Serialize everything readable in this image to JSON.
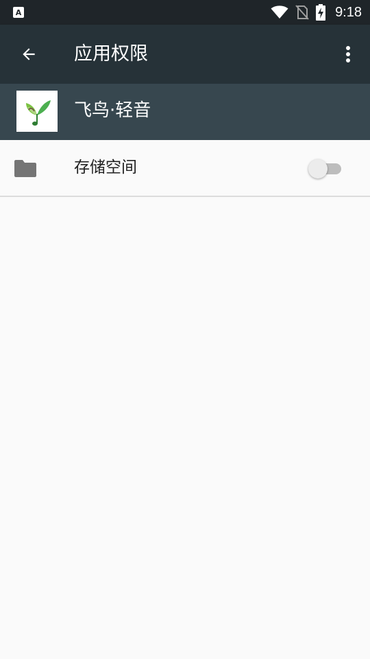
{
  "status_bar": {
    "time": "9:18",
    "icons": [
      "notification-a-icon",
      "wifi-icon",
      "no-sim-icon",
      "battery-charging-icon"
    ]
  },
  "app_bar": {
    "title": "应用权限",
    "back_icon": "arrow-left-icon",
    "menu_icon": "more-vertical-icon"
  },
  "app_header": {
    "app_name": "飞鸟·轻音",
    "app_icon": "bird-leaf-logo-icon"
  },
  "permissions": [
    {
      "label": "存储空间",
      "icon": "folder-icon",
      "enabled": false
    }
  ],
  "colors": {
    "status_bar": "#1f2529",
    "app_bar": "#263238",
    "app_header": "#37474f",
    "background": "#fafafa"
  }
}
